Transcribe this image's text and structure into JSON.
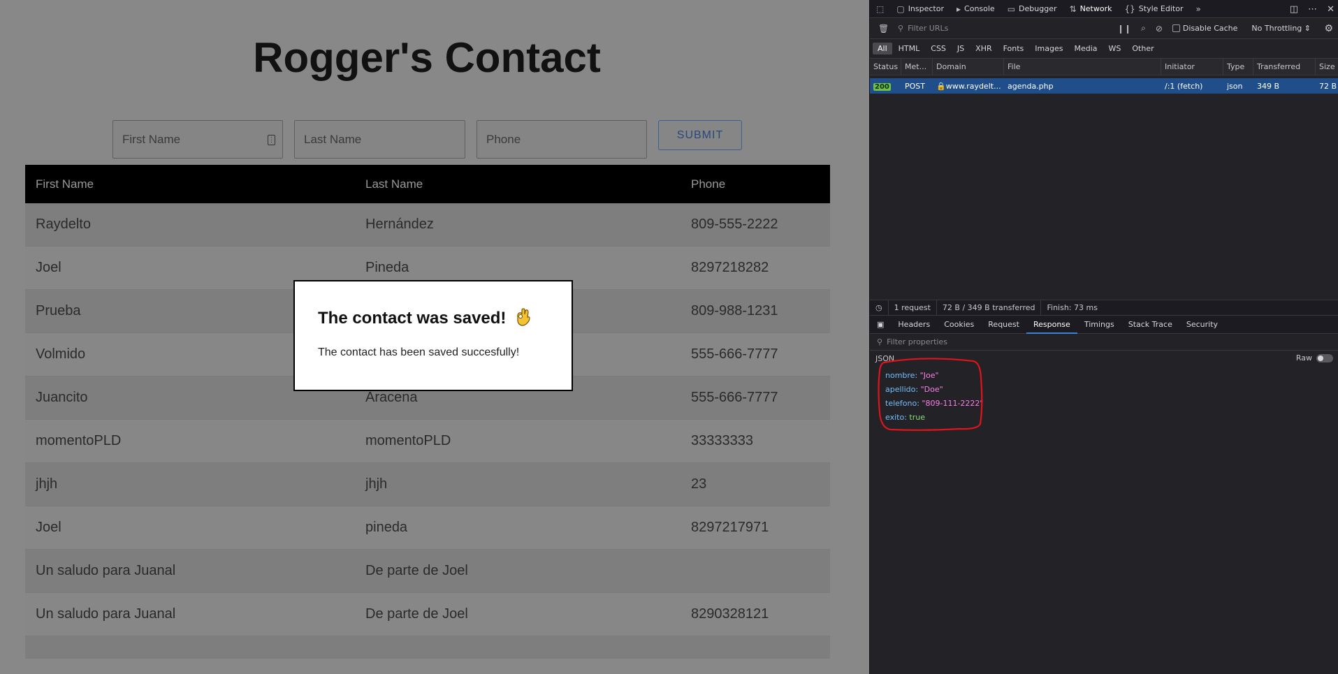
{
  "page": {
    "title": "Rogger's Contact",
    "form": {
      "first_name_placeholder": "First Name",
      "last_name_placeholder": "Last Name",
      "phone_placeholder": "Phone",
      "submit_label": "SUBMIT"
    },
    "table": {
      "headers": [
        "First Name",
        "Last Name",
        "Phone"
      ],
      "rows": [
        [
          "Raydelto",
          "Hernández",
          "809-555-2222"
        ],
        [
          "Joel",
          "Pineda",
          "8297218282"
        ],
        [
          "Prueba",
          "",
          "809-988-1231"
        ],
        [
          "Volmido",
          "",
          "555-666-7777"
        ],
        [
          "Juancito",
          "Aracena",
          "555-666-7777"
        ],
        [
          "momentoPLD",
          "momentoPLD",
          "33333333"
        ],
        [
          "jhjh",
          "jhjh",
          "23"
        ],
        [
          "Joel",
          "pineda",
          "8297217971"
        ],
        [
          "Un saludo para Juanal",
          "De parte de Joel",
          ""
        ],
        [
          "Un saludo para Juanal",
          "De parte de Joel",
          "8290328121"
        ]
      ]
    },
    "modal": {
      "title": "The contact was saved!",
      "body": "The contact has been saved succesfully!"
    }
  },
  "devtools": {
    "tabs": [
      "Inspector",
      "Console",
      "Debugger",
      "Network",
      "Style Editor"
    ],
    "active_tab": "Network",
    "filter_placeholder": "Filter URLs",
    "disable_cache_label": "Disable Cache",
    "throttling_label": "No Throttling",
    "type_filters": [
      "All",
      "HTML",
      "CSS",
      "JS",
      "XHR",
      "Fonts",
      "Images",
      "Media",
      "WS",
      "Other"
    ],
    "columns": [
      "Status",
      "Met...",
      "Domain",
      "File",
      "Initiator",
      "Type",
      "Transferred",
      "Size"
    ],
    "request": {
      "status": "200",
      "method": "POST",
      "domain": "www.raydelt...",
      "file": "agenda.php",
      "initiator": "/:1 (fetch)",
      "type": "json",
      "transferred": "349 B",
      "size": "72 B"
    },
    "summary": {
      "requests": "1 request",
      "transferred": "72 B / 349 B transferred",
      "finish": "Finish: 73 ms"
    },
    "detail_tabs": [
      "Headers",
      "Cookies",
      "Request",
      "Response",
      "Timings",
      "Stack Trace",
      "Security"
    ],
    "active_detail_tab": "Response",
    "filter_properties_placeholder": "Filter properties",
    "json_label": "JSON",
    "raw_label": "Raw",
    "response_json": [
      {
        "key": "nombre",
        "value": "\"Joe\"",
        "kind": "string"
      },
      {
        "key": "apellido",
        "value": "\"Doe\"",
        "kind": "string"
      },
      {
        "key": "telefono",
        "value": "\"809-111-2222\"",
        "kind": "string"
      },
      {
        "key": "exito",
        "value": "true",
        "kind": "bool"
      }
    ],
    "annotation_color": "#e0141e"
  }
}
